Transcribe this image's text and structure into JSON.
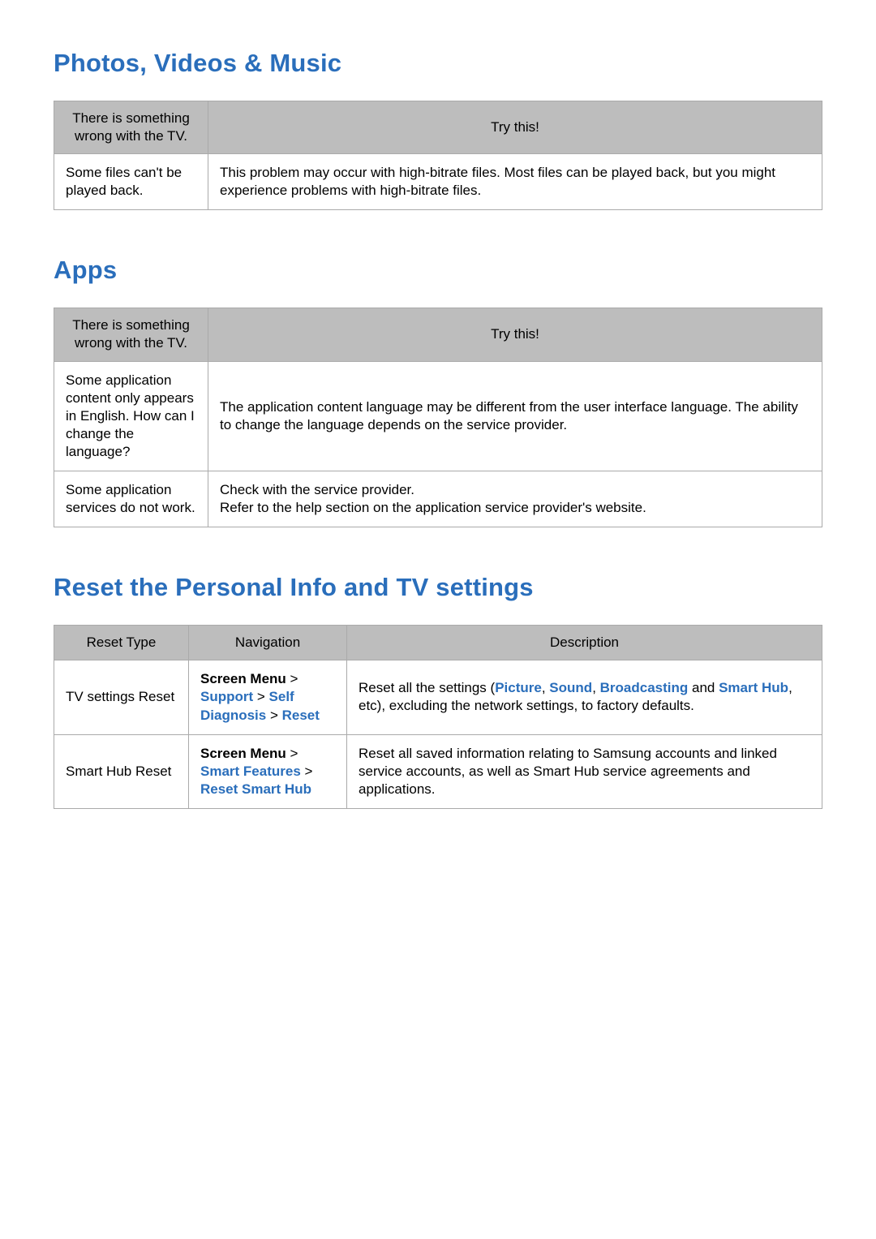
{
  "sections": {
    "pvm": {
      "heading": "Photos, Videos & Music",
      "headers": {
        "col1": "There is something wrong with the TV.",
        "col2": "Try this!"
      },
      "rows": [
        {
          "problem": "Some files can't be played back.",
          "solution": "This problem may occur with high-bitrate files. Most files can be played back, but you might experience problems with high-bitrate files."
        }
      ]
    },
    "apps": {
      "heading": "Apps",
      "headers": {
        "col1": "There is something wrong with the TV.",
        "col2": "Try this!"
      },
      "rows": [
        {
          "problem": "Some application content only appears in English. How can I change the language?",
          "solution": "The application content language may be different from the user interface language. The ability to change the language depends on the service provider."
        },
        {
          "problem": "Some application services do not work.",
          "solution_line1": "Check with the service provider.",
          "solution_line2": "Refer to the help section on the application service provider's website."
        }
      ]
    },
    "reset": {
      "heading": "Reset the Personal Info and TV settings",
      "headers": {
        "col1": "Reset Type",
        "col2": "Navigation",
        "col3": "Description"
      },
      "rows": [
        {
          "type": "TV settings Reset",
          "nav": {
            "p1": "Screen Menu",
            "gt1": " > ",
            "l1": "Support",
            "gt2": " > ",
            "l2": "Self Diagnosis",
            "gt3": " > ",
            "l3": "Reset"
          },
          "desc": {
            "pre": "Reset all the settings (",
            "k1": "Picture",
            "c1": ", ",
            "k2": "Sound",
            "c2": ", ",
            "k3": "Broadcasting",
            "mid": " and ",
            "k4": "Smart Hub",
            "post": ", etc), excluding the network settings, to factory defaults."
          }
        },
        {
          "type": "Smart Hub Reset",
          "nav": {
            "p1": "Screen Menu",
            "gt1": " > ",
            "l1": "Smart Features",
            "gt2": " > ",
            "l2": "Reset Smart Hub"
          },
          "desc_plain": "Reset all saved information relating to Samsung accounts and linked service accounts, as well as Smart Hub service agreements and applications."
        }
      ]
    }
  }
}
